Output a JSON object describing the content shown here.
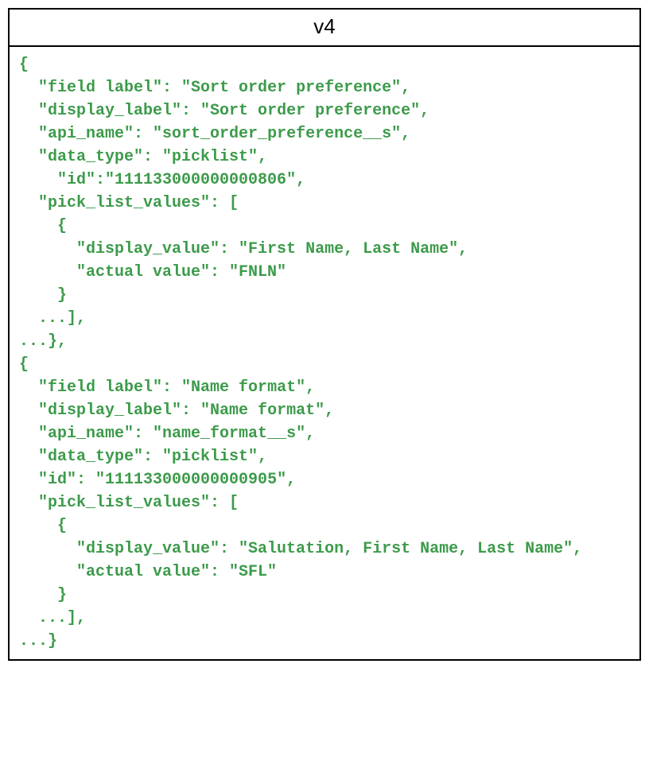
{
  "header": {
    "title": "v4"
  },
  "code": {
    "content": "{\n  \"field label\": \"Sort order preference\",\n  \"display_label\": \"Sort order preference\",\n  \"api_name\": \"sort_order_preference__s\",\n  \"data_type\": \"picklist\",\n    \"id\":\"111133000000000806\",\n  \"pick_list_values\": [\n    {\n      \"display_value\": \"First Name, Last Name\",\n      \"actual value\": \"FNLN\"\n    }\n  ...],\n...},\n{\n  \"field label\": \"Name format\",\n  \"display_label\": \"Name format\",\n  \"api_name\": \"name_format__s\",\n  \"data_type\": \"picklist\",\n  \"id\": \"111133000000000905\",\n  \"pick_list_values\": [\n    {\n      \"display_value\": \"Salutation, First Name, Last Name\",\n      \"actual value\": \"SFL\"\n    }\n  ...],\n...}"
  }
}
